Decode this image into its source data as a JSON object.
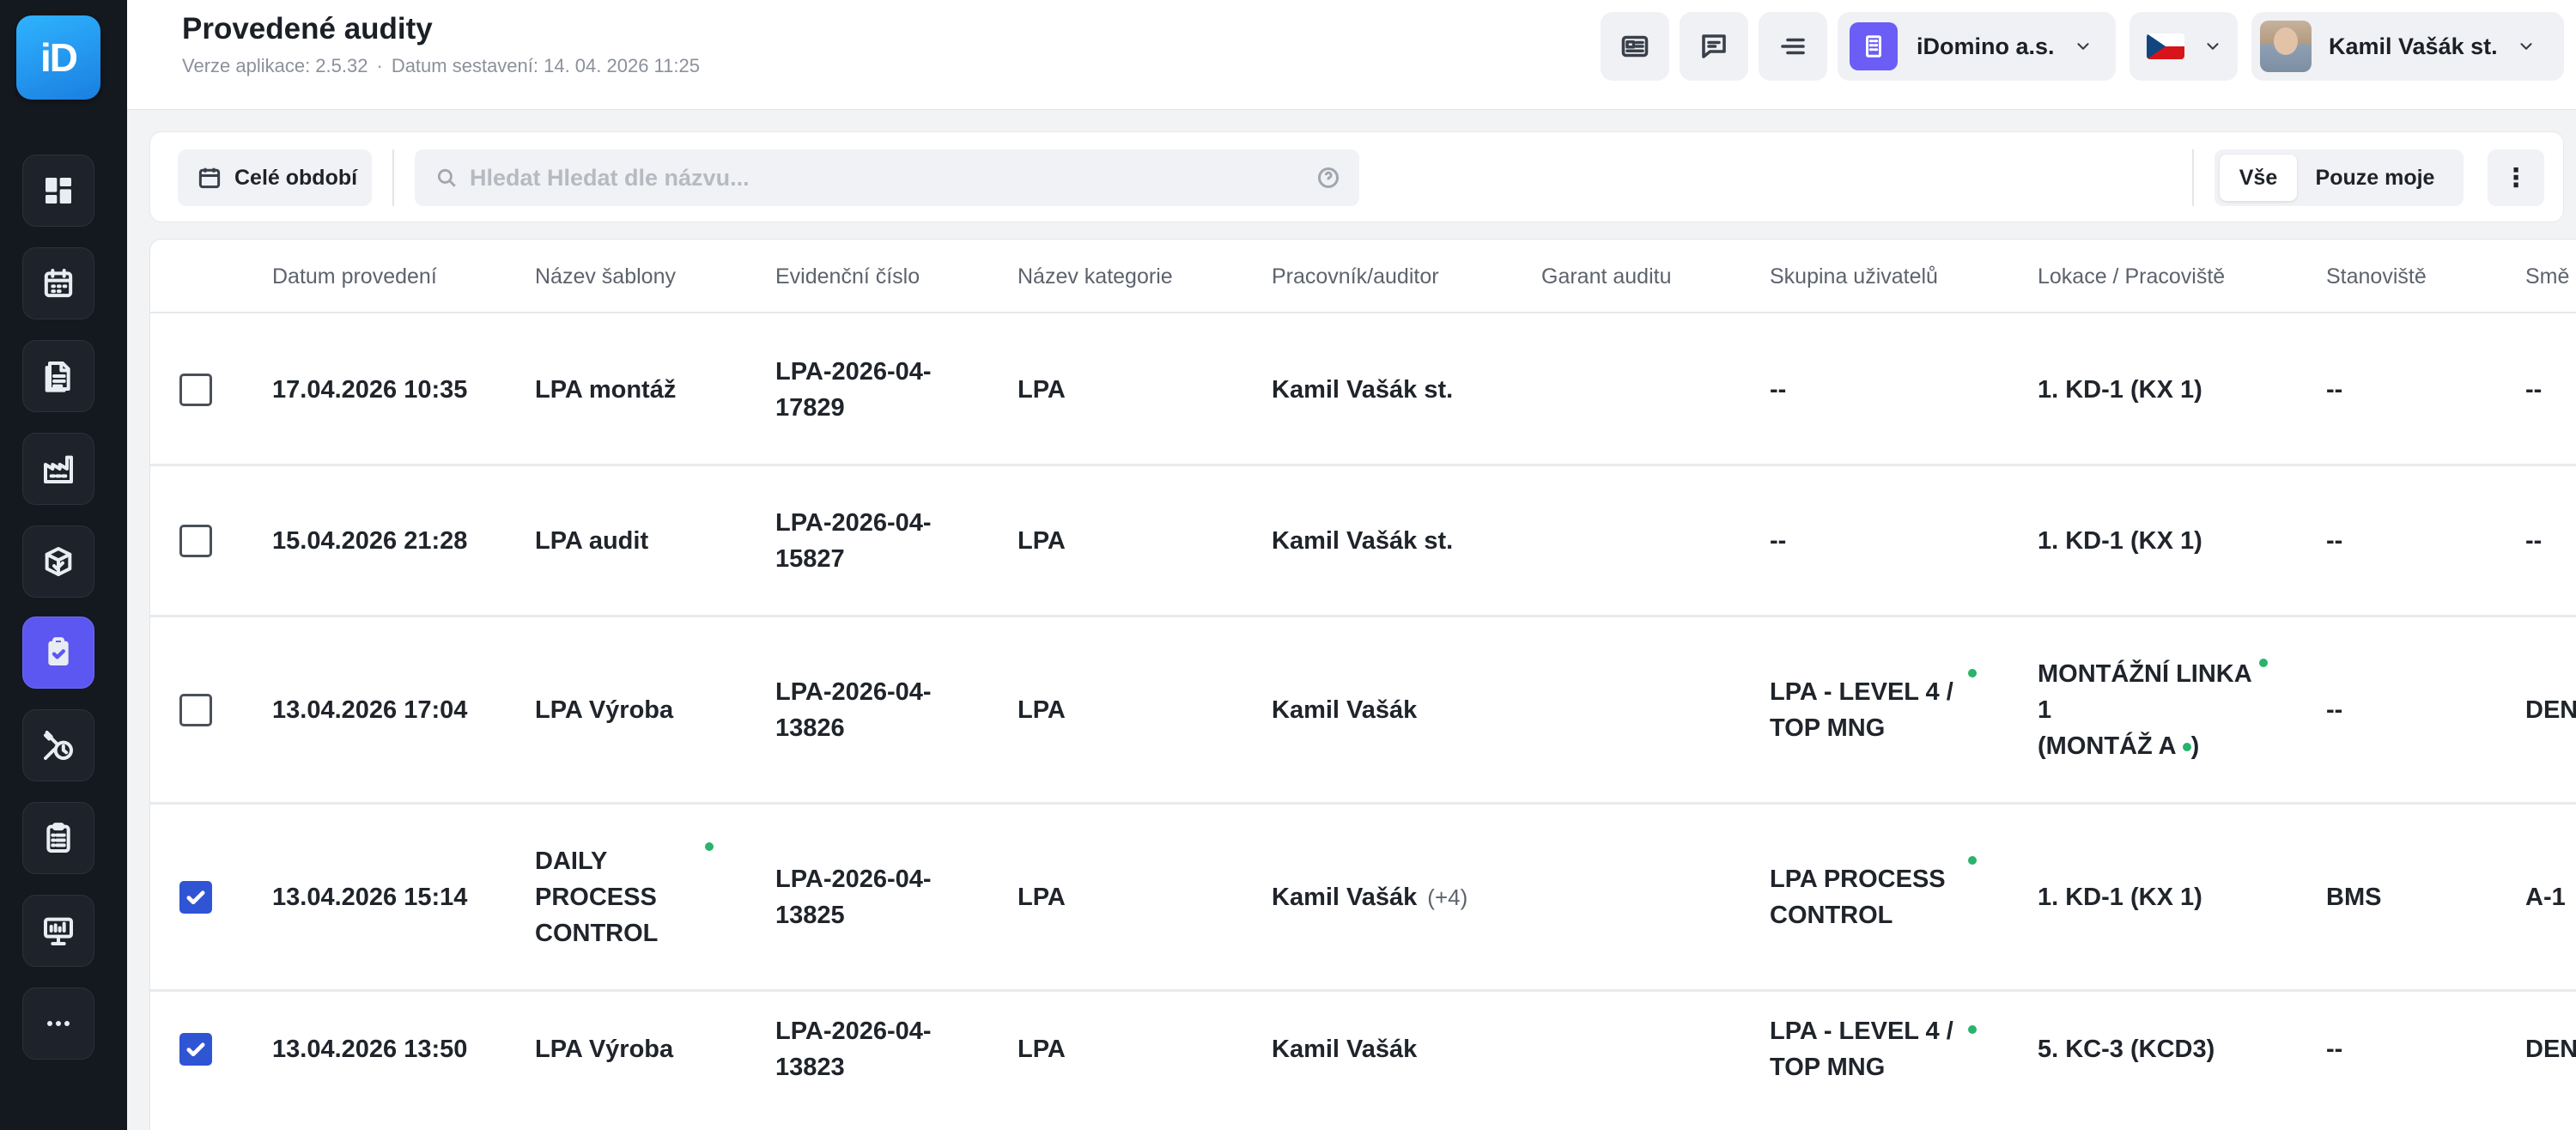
{
  "app": {
    "logo_text": "iD"
  },
  "sidebar": {
    "items": [
      {
        "icon": "dashboard-icon"
      },
      {
        "icon": "calendar-icon"
      },
      {
        "icon": "document-icon"
      },
      {
        "icon": "factory-icon"
      },
      {
        "icon": "package-check-icon"
      },
      {
        "icon": "audit-clipboard-icon",
        "active": true
      },
      {
        "icon": "maintenance-clock-icon"
      },
      {
        "icon": "checklist-icon"
      },
      {
        "icon": "presentation-icon"
      },
      {
        "icon": "more-icon"
      }
    ]
  },
  "header": {
    "title": "Provedené audity",
    "version": "Verze aplikace: 2.5.32",
    "build": "Datum sestavení: 14. 04. 2026 11:25",
    "meta_sep": "·",
    "company": "iDomino a.s.",
    "language": "CZ",
    "user": "Kamil Vašák st."
  },
  "toolbar": {
    "period_label": "Celé období",
    "search_placeholder": "Hledat Hledat dle názvu...",
    "search_value": "",
    "filter_all": "Vše",
    "filter_mine": "Pouze moje",
    "more": "⋮"
  },
  "table": {
    "columns": [
      "Datum provedení",
      "Název šablony",
      "Evidenční číslo",
      "Název kategorie",
      "Pracovník/auditor",
      "Garant auditu",
      "Skupina uživatelů",
      "Lokace / Pracoviště",
      "Stanoviště",
      "Smě"
    ],
    "rows": [
      {
        "checked": false,
        "date": "17.04.2026 10:35",
        "template": "LPA montáž",
        "evid": "LPA-2026-04-17829",
        "category": "LPA",
        "worker": "Kamil Vašák st.",
        "worker_extra": "",
        "garant": "",
        "group": "--",
        "location": "1. KD-1 (KX 1)",
        "location_line2": "",
        "station": "--",
        "shift": "--"
      },
      {
        "checked": false,
        "date": "15.04.2026 21:28",
        "template": "LPA audit",
        "evid": "LPA-2026-04-15827",
        "category": "LPA",
        "worker": "Kamil Vašák st.",
        "worker_extra": "",
        "garant": "",
        "group": "--",
        "location": "1. KD-1 (KX 1)",
        "location_line2": "",
        "station": "--",
        "shift": "--"
      },
      {
        "checked": false,
        "date": "13.04.2026 17:04",
        "template": "LPA Výroba",
        "evid": "LPA-2026-04-13826",
        "category": "LPA",
        "worker": "Kamil Vašák",
        "worker_extra": "",
        "garant": "",
        "group": "LPA - LEVEL 4 / TOP MNG",
        "location": "MONTÁŽNÍ LINKA 1",
        "location_line2": "(MONTÁŽ A",
        "station": "--",
        "shift": "DEN"
      },
      {
        "checked": true,
        "date": "13.04.2026 15:14",
        "template": "DAILY PROCESS CONTROL",
        "evid": "LPA-2026-04-13825",
        "category": "LPA",
        "worker": "Kamil Vašák",
        "worker_extra": "(+4)",
        "garant": "",
        "group": "LPA PROCESS CONTROL",
        "location": "1. KD-1 (KX 1)",
        "location_line2": "",
        "station": "BMS",
        "shift": "A-1"
      },
      {
        "checked": true,
        "date": "13.04.2026 13:50",
        "template": "LPA Výroba",
        "evid": "LPA-2026-04-13823",
        "category": "LPA",
        "worker": "Kamil Vašák",
        "worker_extra": "",
        "garant": "",
        "group": "LPA - LEVEL 4 / TOP MNG",
        "location": "5. KC-3 (KCD3)",
        "location_line2": "",
        "station": "--",
        "shift": "DEN"
      }
    ]
  }
}
